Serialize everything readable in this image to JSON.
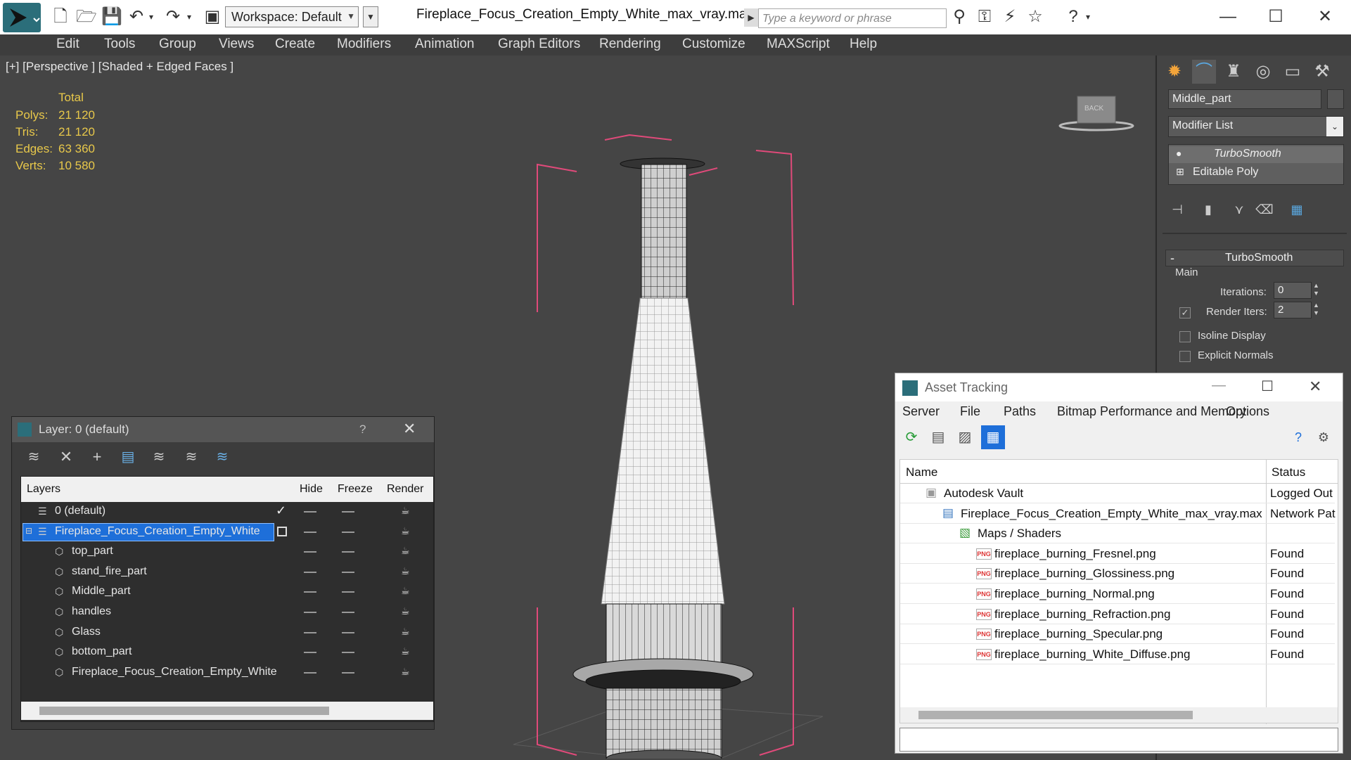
{
  "window": {
    "title": "Fireplace_Focus_Creation_Empty_White_max_vray.max",
    "workspace": "Workspace: Default",
    "search_placeholder": "Type a keyword or phrase"
  },
  "menu": [
    "Edit",
    "Tools",
    "Group",
    "Views",
    "Create",
    "Modifiers",
    "Animation",
    "Graph Editors",
    "Rendering",
    "Customize",
    "MAXScript",
    "Help"
  ],
  "viewport": {
    "label": "[+] [Perspective ] [Shaded + Edged Faces ]",
    "stats": {
      "header": "Total",
      "rows": [
        {
          "label": "Polys:",
          "value": "21 120"
        },
        {
          "label": "Tris:",
          "value": "21 120"
        },
        {
          "label": "Edges:",
          "value": "63 360"
        },
        {
          "label": "Verts:",
          "value": "10 580"
        }
      ]
    },
    "viewcube_text": "BACK"
  },
  "command_panel": {
    "object_name": "Middle_part",
    "modifier_list": "Modifier List",
    "stack": [
      "TurboSmooth",
      "Editable Poly"
    ],
    "rollout_title": "TurboSmooth",
    "group_main": "Main",
    "iterations_label": "Iterations:",
    "iterations_value": "0",
    "render_iters_label": "Render Iters:",
    "render_iters_value": "2",
    "isoline_label": "Isoline Display",
    "explicit_label": "Explicit Normals"
  },
  "layer_dialog": {
    "title": "Layer: 0 (default)",
    "help": "?",
    "columns": [
      "Layers",
      "Hide",
      "Freeze",
      "Render"
    ],
    "rows": [
      {
        "name": "0 (default)",
        "indent": 1,
        "selected": false
      },
      {
        "name": "Fireplace_Focus_Creation_Empty_White",
        "indent": 1,
        "selected": true
      },
      {
        "name": "top_part",
        "indent": 2,
        "selected": false
      },
      {
        "name": "stand_fire_part",
        "indent": 2,
        "selected": false
      },
      {
        "name": "Middle_part",
        "indent": 2,
        "selected": false
      },
      {
        "name": "handles",
        "indent": 2,
        "selected": false
      },
      {
        "name": "Glass",
        "indent": 2,
        "selected": false
      },
      {
        "name": "bottom_part",
        "indent": 2,
        "selected": false
      },
      {
        "name": "Fireplace_Focus_Creation_Empty_White",
        "indent": 2,
        "selected": false
      }
    ]
  },
  "asset_dialog": {
    "title": "Asset Tracking",
    "menu": [
      "Server",
      "File",
      "Paths",
      "Bitmap Performance and Memory",
      "Options"
    ],
    "columns": [
      "Name",
      "Status"
    ],
    "rows": [
      {
        "name": "Autodesk Vault",
        "status": "Logged Out",
        "level": 1,
        "icon": "vault-icon"
      },
      {
        "name": "Fireplace_Focus_Creation_Empty_White_max_vray.max",
        "status": "Network Pat",
        "level": 2,
        "icon": "max-file-icon"
      },
      {
        "name": "Maps / Shaders",
        "status": "",
        "level": 3,
        "icon": "maps-icon"
      },
      {
        "name": "fireplace_burning_Fresnel.png",
        "status": "Found",
        "level": 4,
        "icon": "png-icon"
      },
      {
        "name": "fireplace_burning_Glossiness.png",
        "status": "Found",
        "level": 4,
        "icon": "png-icon"
      },
      {
        "name": "fireplace_burning_Normal.png",
        "status": "Found",
        "level": 4,
        "icon": "png-icon"
      },
      {
        "name": "fireplace_burning_Refraction.png",
        "status": "Found",
        "level": 4,
        "icon": "png-icon"
      },
      {
        "name": "fireplace_burning_Specular.png",
        "status": "Found",
        "level": 4,
        "icon": "png-icon"
      },
      {
        "name": "fireplace_burning_White_Diffuse.png",
        "status": "Found",
        "level": 4,
        "icon": "png-icon"
      }
    ],
    "png_badge": "PNG"
  },
  "colors": {
    "accent_blue": "#1e6fd9",
    "stats_yellow": "#e8c84a",
    "bbox_pink": "#e04a7a"
  }
}
